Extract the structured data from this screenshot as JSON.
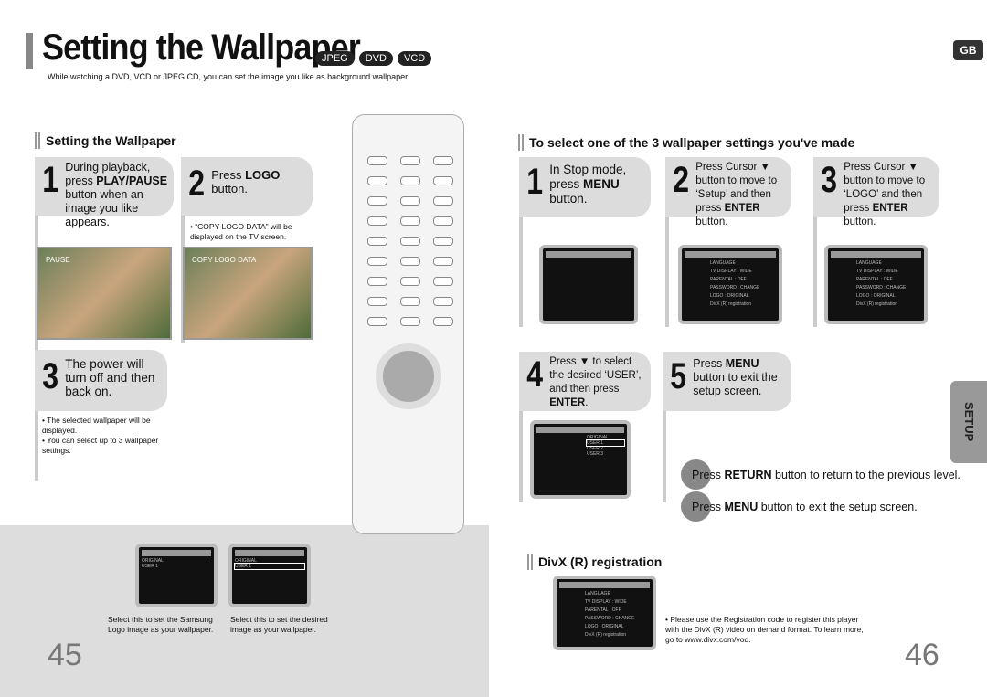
{
  "header": {
    "title": "Setting the Wallpaper",
    "badges": [
      "JPEG",
      "DVD",
      "VCD"
    ],
    "subtitle": "While watching a DVD, VCD or JPEG CD, you can set the image you like as background wallpaper.",
    "lang_badge": "GB"
  },
  "left": {
    "section_title": "Setting the Wallpaper",
    "steps": [
      {
        "num": "1",
        "pre": "During playback, press ",
        "bold": "PLAY/PAUSE",
        "post": " button when an image you like appears."
      },
      {
        "num": "2",
        "pre": "Press ",
        "bold": "LOGO",
        "post": " button."
      },
      {
        "num": "3",
        "pre": "The power will turn off and then back on.",
        "bold": "",
        "post": ""
      }
    ],
    "step2_note": "• “COPY LOGO DATA” will be displayed on the TV screen.",
    "photo1_label": "PAUSE",
    "photo2_label": "COPY LOGO DATA",
    "step3_notes": [
      "• The selected wallpaper will be displayed.",
      "• You can select up to 3 wallpaper settings."
    ],
    "captions": [
      "Select this to set the Samsung Logo image as your wallpaper.",
      "Select this to set the desired image as your wallpaper."
    ],
    "page_number": "45"
  },
  "right": {
    "section_title": "To select one of the 3 wallpaper settings you've made",
    "steps": [
      {
        "num": "1",
        "pre": "In Stop mode, press ",
        "bold": "MENU",
        "post": " button."
      },
      {
        "num": "2",
        "pre": "Press Cursor ▼ button to move to ‘Setup’ and then press ",
        "bold": "ENTER",
        "post": " button."
      },
      {
        "num": "3",
        "pre": "Press Cursor ▼ button to move to ‘LOGO’ and then press ",
        "bold": "ENTER",
        "post": " button."
      },
      {
        "num": "4",
        "pre": "Press ▼ to select the desired ‘USER’, and then press ",
        "bold": "ENTER",
        "post": "."
      },
      {
        "num": "5",
        "pre": "Press ",
        "bold": "MENU",
        "post": " button to exit the setup screen."
      }
    ],
    "tips": [
      {
        "pre": "Press ",
        "bold": "RETURN",
        "post": " button to return to the previous level."
      },
      {
        "pre": "Press ",
        "bold": "MENU",
        "post": " button to exit the setup screen."
      }
    ],
    "side_tab": "SETUP",
    "divx_title": "DivX (R) registration",
    "divx_note": "• Please use the Registration code to register this player with the DivX (R) video on demand format. To learn more, go to www.divx.com/vod.",
    "page_number": "46"
  },
  "screen_menu": {
    "header_right": "SETUP",
    "items": [
      "LANGUAGE",
      "TV DISPLAY : WIDE",
      "PARENTAL : OFF",
      "PASSWORD : CHANGE",
      "LOGO : ORIGINAL",
      "DivX (R) registration"
    ],
    "logo_options": [
      "ORIGINAL",
      "USER 1",
      "USER 2",
      "USER 3"
    ]
  }
}
